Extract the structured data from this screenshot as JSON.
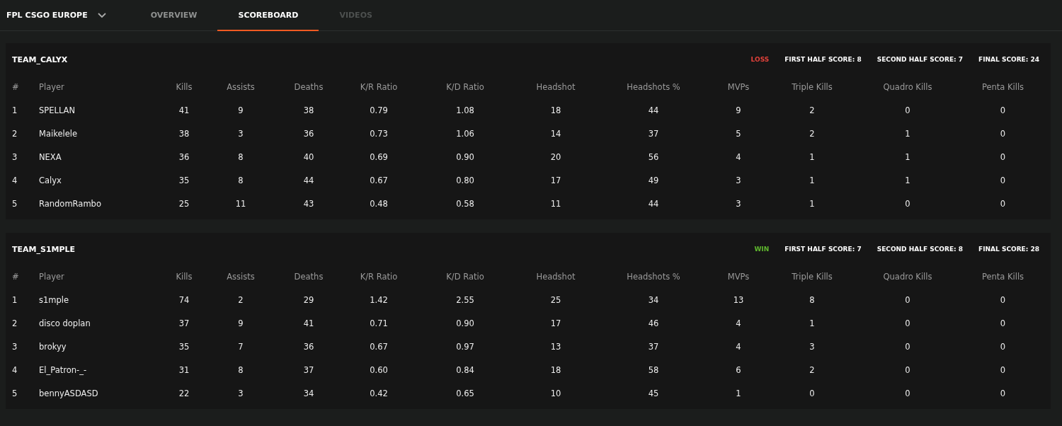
{
  "nav": {
    "event": "FPL CSGO EUROPE",
    "tabs": [
      {
        "label": "OVERVIEW",
        "selected": false,
        "disabled": false
      },
      {
        "label": "SCOREBOARD",
        "selected": true,
        "disabled": false
      },
      {
        "label": "VIDEOS",
        "selected": false,
        "disabled": true
      }
    ]
  },
  "teams": [
    {
      "name": "TEAM_CALYX",
      "result": {
        "text": "LOSS",
        "kind": "loss"
      },
      "scores": [
        "FIRST HALF SCORE: 8",
        "SECOND HALF SCORE: 7",
        "FINAL SCORE: 24"
      ],
      "columns": [
        "#",
        "Player",
        "Kills",
        "Assists",
        "Deaths",
        "K/R Ratio",
        "K/D Ratio",
        "Headshot",
        "Headshots %",
        "MVPs",
        "Triple Kills",
        "Quadro Kills",
        "Penta Kills"
      ],
      "rows": [
        [
          "1",
          "SPELLAN",
          "41",
          "9",
          "38",
          "0.79",
          "1.08",
          "18",
          "44",
          "9",
          "2",
          "0",
          "0"
        ],
        [
          "2",
          "Maikelele",
          "38",
          "3",
          "36",
          "0.73",
          "1.06",
          "14",
          "37",
          "5",
          "2",
          "1",
          "0"
        ],
        [
          "3",
          "NEXA",
          "36",
          "8",
          "40",
          "0.69",
          "0.90",
          "20",
          "56",
          "4",
          "1",
          "1",
          "0"
        ],
        [
          "4",
          "Calyx",
          "35",
          "8",
          "44",
          "0.67",
          "0.80",
          "17",
          "49",
          "3",
          "1",
          "1",
          "0"
        ],
        [
          "5",
          "RandomRambo",
          "25",
          "11",
          "43",
          "0.48",
          "0.58",
          "11",
          "44",
          "3",
          "1",
          "0",
          "0"
        ]
      ]
    },
    {
      "name": "TEAM_S1MPLE",
      "result": {
        "text": "WIN",
        "kind": "win"
      },
      "scores": [
        "FIRST HALF SCORE: 7",
        "SECOND HALF SCORE: 8",
        "FINAL SCORE: 28"
      ],
      "columns": [
        "#",
        "Player",
        "Kills",
        "Assists",
        "Deaths",
        "K/R Ratio",
        "K/D Ratio",
        "Headshot",
        "Headshots %",
        "MVPs",
        "Triple Kills",
        "Quadro Kills",
        "Penta Kills"
      ],
      "rows": [
        [
          "1",
          "s1mple",
          "74",
          "2",
          "29",
          "1.42",
          "2.55",
          "25",
          "34",
          "13",
          "8",
          "0",
          "0"
        ],
        [
          "2",
          "disco doplan",
          "37",
          "9",
          "41",
          "0.71",
          "0.90",
          "17",
          "46",
          "4",
          "1",
          "0",
          "0"
        ],
        [
          "3",
          "brokyy",
          "35",
          "7",
          "36",
          "0.67",
          "0.97",
          "13",
          "37",
          "4",
          "3",
          "0",
          "0"
        ],
        [
          "4",
          "El_Patron-_-",
          "31",
          "8",
          "37",
          "0.60",
          "0.84",
          "18",
          "58",
          "6",
          "2",
          "0",
          "0"
        ],
        [
          "5",
          "bennyASDASD",
          "22",
          "3",
          "34",
          "0.42",
          "0.65",
          "10",
          "45",
          "1",
          "0",
          "0",
          "0"
        ]
      ]
    }
  ]
}
